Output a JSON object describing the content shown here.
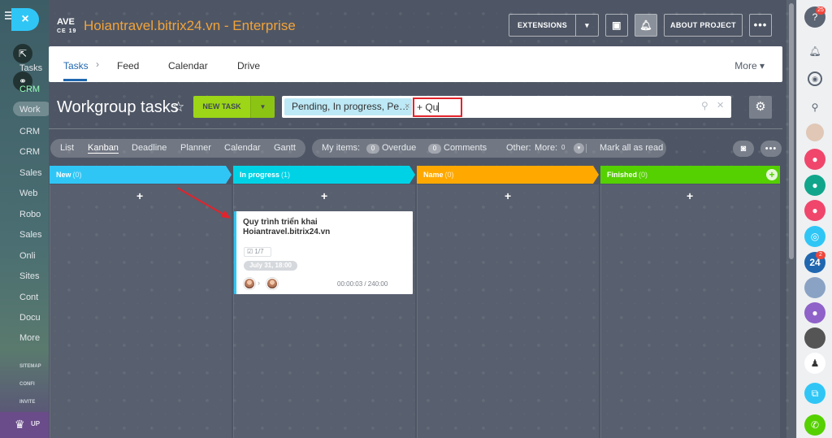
{
  "left_sidebar": {
    "close_label": "×",
    "items": [
      "Stream",
      "Tasks",
      "CRM",
      "Work",
      "CRM",
      "CRM",
      "Sales",
      "Web",
      "Robo",
      "Sales",
      "Onli",
      "Sites",
      "Cont",
      "Docu",
      "More"
    ],
    "small_items": [
      "SITEMAP",
      "CONFI",
      "INVITE"
    ],
    "bottom_label": "UP"
  },
  "header": {
    "logo_line1": "AVE",
    "logo_line2": "CE 19",
    "site_title": "Hoiantravel.bitrix24.vn - Enterprise",
    "extensions_label": "EXTENSIONS",
    "about_label": "ABOUT PROJECT"
  },
  "tabs": {
    "items": [
      "Tasks",
      "Feed",
      "Calendar",
      "Drive"
    ],
    "more_label": "More"
  },
  "toolbar": {
    "page_title": "Workgroup tasks",
    "new_task_label": "NEW TASK",
    "filter_chip": "Pending, In progress, Pe…",
    "filter_input_value": "+ Qu"
  },
  "views": {
    "items": [
      "List",
      "Kanban",
      "Deadline",
      "Planner",
      "Calendar",
      "Gantt"
    ],
    "active": "Kanban"
  },
  "counters": {
    "my_items_label": "My items:",
    "overdue_count": "0",
    "overdue_label": "Overdue",
    "comments_count": "0",
    "comments_label": "Comments",
    "other_label": "Other:",
    "more_label": "More:",
    "more_count": "0",
    "mark_all_label": "Mark all as read"
  },
  "kanban": {
    "columns": [
      {
        "name": "New",
        "count": "(0)",
        "color": "#2fc6f6"
      },
      {
        "name": "In progress",
        "count": "(1)",
        "color": "#00d2e6"
      },
      {
        "name": "Name",
        "count": "(0)",
        "color": "#ffa900"
      },
      {
        "name": "Finished",
        "count": "(0)",
        "color": "#55d000"
      }
    ],
    "add_label": "+",
    "card": {
      "title": "Quy trình triển khai Hoiantravel.bitrix24.vn",
      "checklist": "1/7",
      "deadline": "July 31, 18:00",
      "time": "00:00:03 / 240:00"
    }
  },
  "right_sidebar": {
    "help_count": "25",
    "badge_24": "24",
    "badge_24_count": "2"
  }
}
